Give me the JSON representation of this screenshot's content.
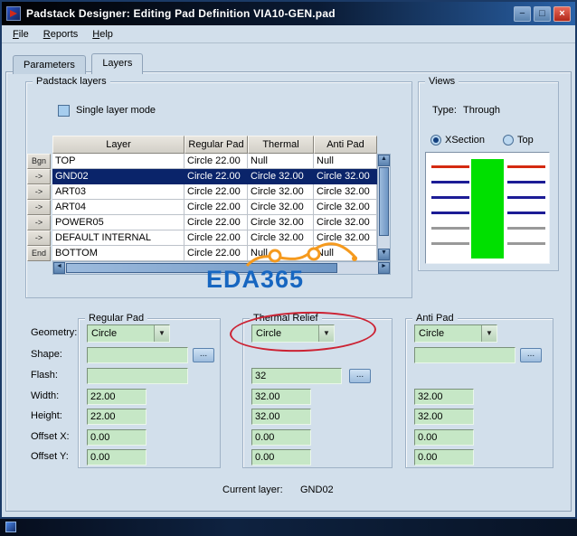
{
  "window": {
    "title": "Padstack Designer: Editing Pad Definition VIA10-GEN.pad",
    "minimize_glyph": "−",
    "maximize_glyph": "□",
    "close_glyph": "×"
  },
  "menubar": {
    "items": [
      "File",
      "Reports",
      "Help"
    ]
  },
  "tabs": {
    "parameters": "Parameters",
    "layers": "Layers"
  },
  "padstack": {
    "group_title": "Padstack layers",
    "single_layer_mode": "Single layer mode",
    "headers": [
      "Layer",
      "Regular Pad",
      "Thermal Relief",
      "Anti Pad"
    ],
    "rows": [
      {
        "marker": "Bgn",
        "layer": "TOP",
        "regular": "Circle 22.00",
        "thermal": "Null",
        "anti": "Null"
      },
      {
        "marker": "->",
        "layer": "GND02",
        "regular": "Circle 22.00",
        "thermal": "Circle 32.00",
        "anti": "Circle 32.00"
      },
      {
        "marker": "->",
        "layer": "ART03",
        "regular": "Circle 22.00",
        "thermal": "Circle 32.00",
        "anti": "Circle 32.00"
      },
      {
        "marker": "->",
        "layer": "ART04",
        "regular": "Circle 22.00",
        "thermal": "Circle 32.00",
        "anti": "Circle 32.00"
      },
      {
        "marker": "->",
        "layer": "POWER05",
        "regular": "Circle 22.00",
        "thermal": "Circle 32.00",
        "anti": "Circle 32.00"
      },
      {
        "marker": "->",
        "layer": "DEFAULT INTERNAL",
        "regular": "Circle 22.00",
        "thermal": "Circle 32.00",
        "anti": "Circle 32.00"
      },
      {
        "marker": "End",
        "layer": "BOTTOM",
        "regular": "Circle 22.00",
        "thermal": "Null",
        "anti": "Null"
      }
    ],
    "selected_layer": "GND02"
  },
  "views": {
    "group_title": "Views",
    "type_label": "Type:",
    "type_value": "Through",
    "radio_xsection": "XSection",
    "radio_top": "Top",
    "xsection": {
      "pad_color": "#00e000",
      "line_colors": [
        "#d42a10",
        "#1c1c96",
        "#1c1c96",
        "#1c1c96",
        "#999999",
        "#999999"
      ]
    }
  },
  "pads": {
    "labels": {
      "geometry": "Geometry:",
      "shape": "Shape:",
      "flash": "Flash:",
      "width": "Width:",
      "height": "Height:",
      "offset_x": "Offset X:",
      "offset_y": "Offset Y:"
    },
    "browse_label": "...",
    "regular": {
      "title": "Regular Pad",
      "geometry": "Circle",
      "shape": "",
      "flash": "",
      "width": "22.00",
      "height": "22.00",
      "offset_x": "0.00",
      "offset_y": "0.00"
    },
    "thermal": {
      "title": "Thermal Relief",
      "geometry": "Circle",
      "flash": "32",
      "width": "32.00",
      "height": "32.00",
      "offset_x": "0.00",
      "offset_y": "0.00"
    },
    "anti": {
      "title": "Anti Pad",
      "geometry": "Circle",
      "shape": "",
      "width": "32.00",
      "height": "32.00",
      "offset_x": "0.00",
      "offset_y": "0.00"
    }
  },
  "footer": {
    "current_layer_label": "Current layer:",
    "current_layer_value": "GND02"
  },
  "watermark": {
    "text": "EDA365",
    "color": "#1766c0",
    "accent": "#f59a1e"
  }
}
